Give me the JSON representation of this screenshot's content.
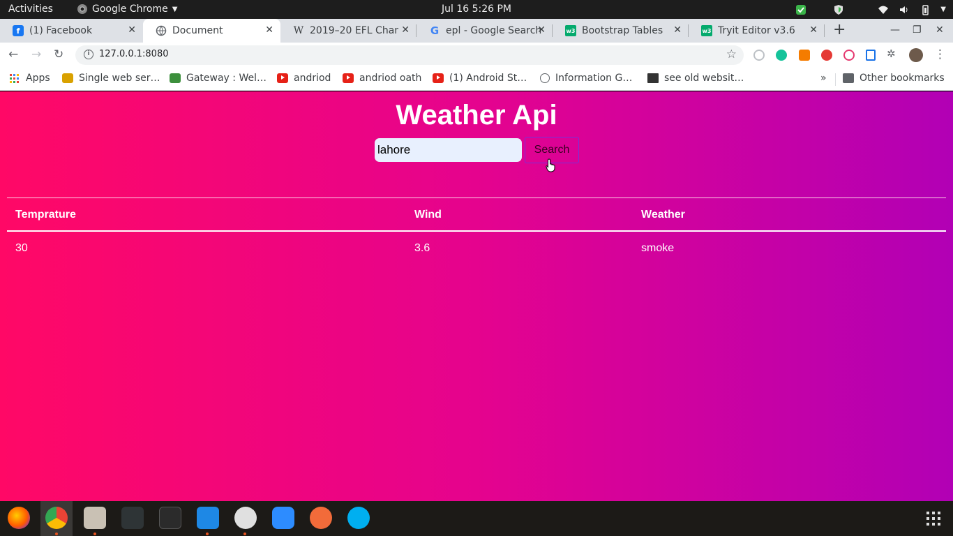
{
  "system_bar": {
    "activities": "Activities",
    "app_name": "Google Chrome",
    "clock": "Jul 16   5:26 PM"
  },
  "tabs": [
    {
      "title": "(1) Facebook",
      "icon": "facebook-icon"
    },
    {
      "title": "Document",
      "icon": "globe-icon",
      "active": true
    },
    {
      "title": "2019–20 EFL Champ",
      "icon": "wikipedia-icon"
    },
    {
      "title": "epl - Google Search",
      "icon": "google-icon"
    },
    {
      "title": "Bootstrap Tables",
      "icon": "w3schools-icon"
    },
    {
      "title": "Tryit Editor v3.6",
      "icon": "w3schools-icon"
    }
  ],
  "address_bar": {
    "url": "127.0.0.1:8080"
  },
  "bookmarks": [
    {
      "label": "Apps",
      "icon": "apps-grid-icon"
    },
    {
      "label": "Single web ser…",
      "icon": "bookmark-site-icon"
    },
    {
      "label": "Gateway : Wel…",
      "icon": "bookmark-site-icon"
    },
    {
      "label": "andriod",
      "icon": "youtube-icon"
    },
    {
      "label": "andriod oath",
      "icon": "youtube-icon"
    },
    {
      "label": "(1) Android St…",
      "icon": "youtube-icon"
    },
    {
      "label": "Information G…",
      "icon": "globe-icon"
    },
    {
      "label": "see old websit…",
      "icon": "archive-icon"
    }
  ],
  "bookmarks_overflow": "»",
  "other_bookmarks": "Other bookmarks",
  "page": {
    "title": "Weather Api",
    "search_value": "lahore",
    "search_button": "Search",
    "table": {
      "headers": [
        "Temprature",
        "Wind",
        "Weather"
      ],
      "rows": [
        [
          "30",
          "3.6",
          "smoke"
        ]
      ]
    }
  },
  "colors": {
    "gradient_start": "#ff0866",
    "gradient_end": "#b200b5",
    "input_bg": "#e8f0fe"
  }
}
